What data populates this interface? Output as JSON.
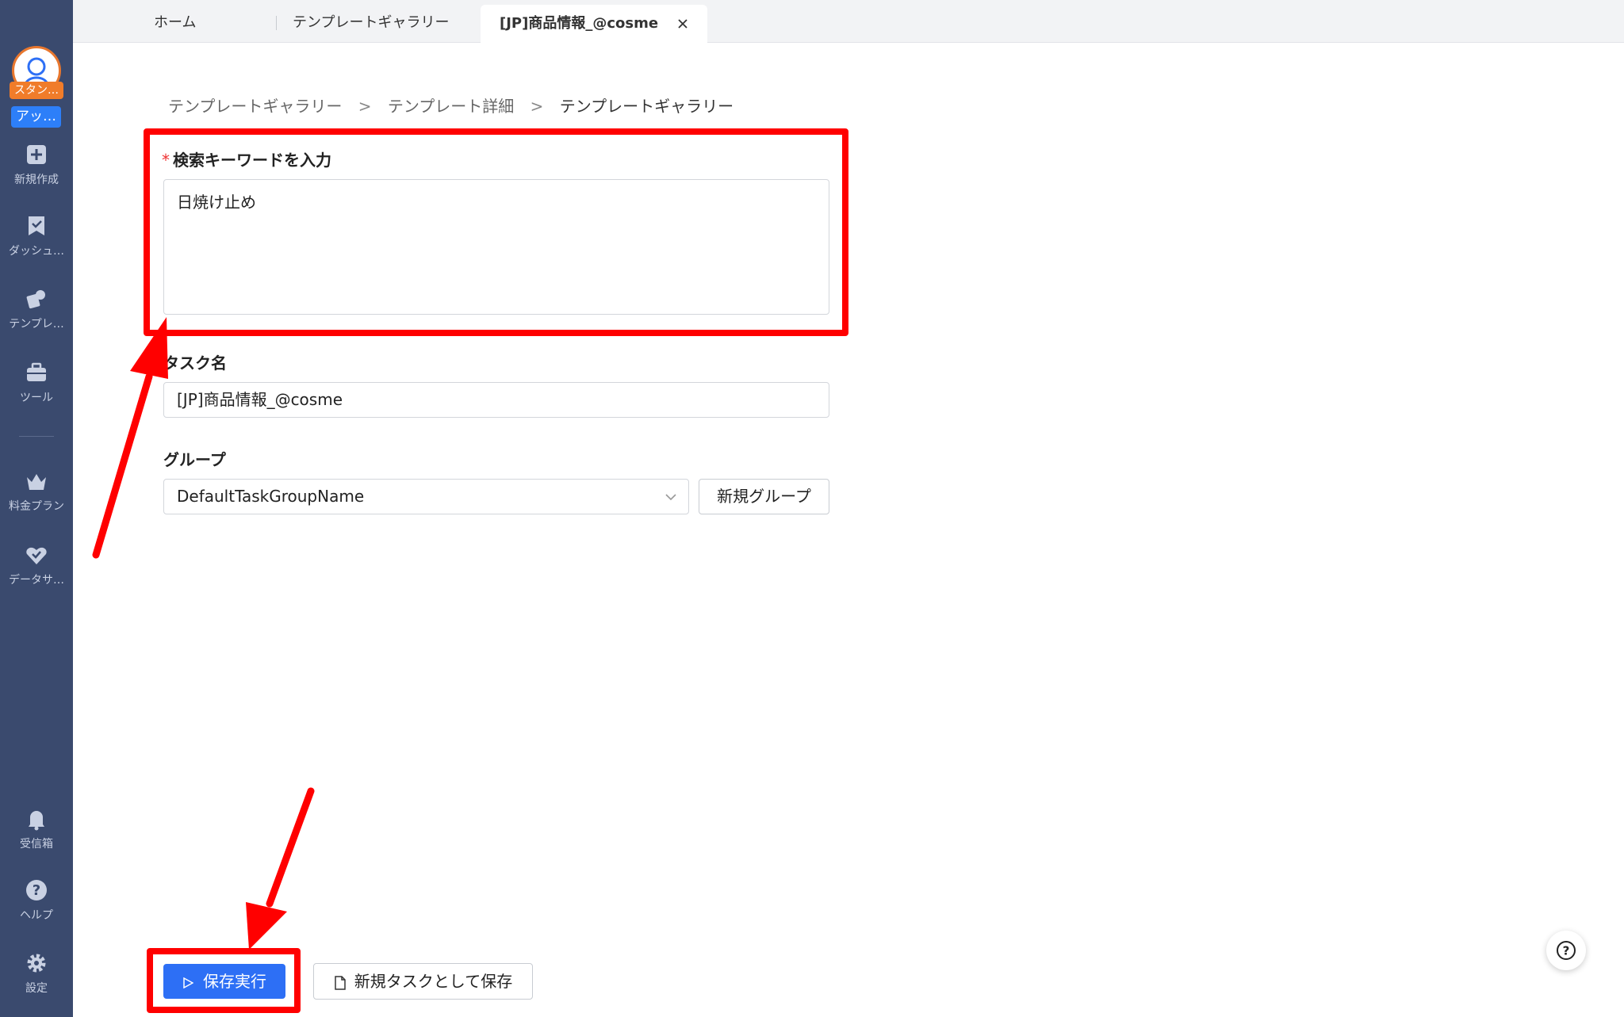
{
  "sidebar": {
    "plan_badge": "スタン…",
    "upgrade_badge": "アッ…",
    "items": [
      {
        "label": "新規作成",
        "icon": "plus-square-icon"
      },
      {
        "label": "ダッシュ…",
        "icon": "bookmark-check-icon"
      },
      {
        "label": "テンプレ…",
        "icon": "template-icon"
      },
      {
        "label": "ツール",
        "icon": "toolbox-icon"
      },
      {
        "label": "料金プラン",
        "icon": "crown-icon"
      },
      {
        "label": "データサ…",
        "icon": "heart-check-icon"
      },
      {
        "label": "受信箱",
        "icon": "bell-icon"
      },
      {
        "label": "ヘルプ",
        "icon": "question-circle-icon"
      },
      {
        "label": "設定",
        "icon": "gear-icon"
      }
    ]
  },
  "tabs": [
    {
      "label": "ホーム"
    },
    {
      "label": "テンプレートギャラリー"
    },
    {
      "label": "[JP]商品情報_@cosme"
    }
  ],
  "breadcrumb": {
    "items": [
      "テンプレートギャラリー",
      "テンプレート詳細",
      "テンプレートギャラリー"
    ],
    "separator": ">"
  },
  "form": {
    "keyword_label": "検索キーワードを入力",
    "required_mark": "*",
    "keyword_value": "日焼け止め",
    "task_name_label": "タスク名",
    "task_name_value": "[JP]商品情報_@cosme",
    "group_label": "グループ",
    "group_value": "DefaultTaskGroupName",
    "new_group_button": "新規グループ"
  },
  "actions": {
    "save_run": "保存実行",
    "save_as_new": "新規タスクとして保存"
  },
  "colors": {
    "sidebar_bg": "#3a4a6e",
    "primary": "#2d6ff5",
    "annotation": "#ff0000",
    "plan_badge": "#f07c2a",
    "upgrade_badge": "#2d7ff9"
  }
}
